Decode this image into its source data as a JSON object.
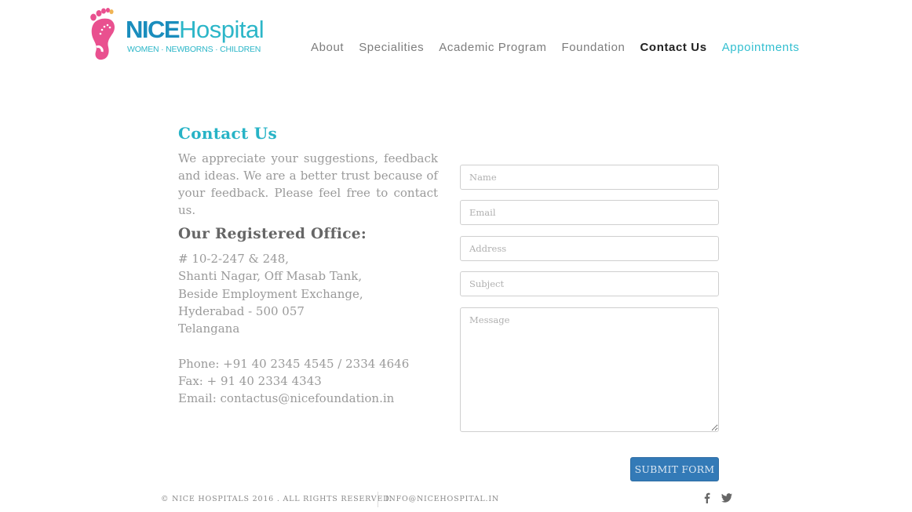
{
  "header": {
    "logo": {
      "brand_bold": "NICE",
      "brand_light": "Hospital",
      "tagline": "WOMEN · NEWBORNS · CHILDREN",
      "icon": "foot-icon"
    },
    "nav": [
      {
        "label": "About",
        "active": false
      },
      {
        "label": "Specialities",
        "active": false
      },
      {
        "label": "Academic Program",
        "active": false
      },
      {
        "label": "Foundation",
        "active": false
      },
      {
        "label": "Contact Us",
        "active": true
      },
      {
        "label": "Appointments",
        "active": false
      }
    ]
  },
  "contact": {
    "title": "Contact Us",
    "intro": "We appreciate your suggestions, feedback and ideas. We are a better trust because of your feedback. Please feel free to contact us.",
    "office_title": "Our Registered Office:",
    "address_lines": [
      "# 10-2-247 & 248,",
      "Shanti Nagar, Off Masab Tank,",
      "Beside Employment Exchange,",
      "Hyderabad - 500 057",
      "Telangana"
    ],
    "phone": "Phone: +91 40 2345 4545 / 2334 4646",
    "fax": "Fax: + 91 40 2334 4343",
    "email": "Email: contactus@nicefoundation.in"
  },
  "form": {
    "name": {
      "placeholder": "Name",
      "value": ""
    },
    "email": {
      "placeholder": "Email",
      "value": ""
    },
    "address": {
      "placeholder": "Address",
      "value": ""
    },
    "subject": {
      "placeholder": "Subject",
      "value": ""
    },
    "message": {
      "placeholder": "Message",
      "value": ""
    },
    "submit_label": "SUBMIT FORM"
  },
  "footer": {
    "copyright": "© NICE HOSPITALS 2016 . ALL RIGHTS RESERVED.",
    "email": "INFO@NICEHOSPITAL.IN",
    "social": [
      "facebook-icon",
      "twitter-icon"
    ]
  },
  "colors": {
    "brand_blue": "#1a8dbd",
    "brand_teal": "#2cb6c8",
    "accent_pink": "#e9508f",
    "button_blue": "#337ab7"
  }
}
